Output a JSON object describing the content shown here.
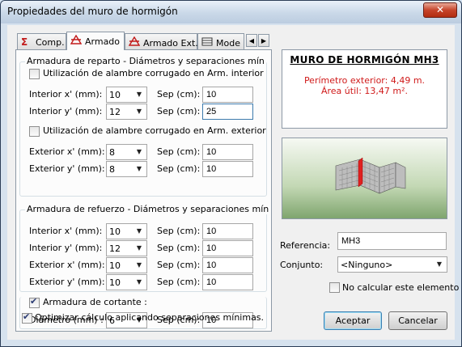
{
  "window": {
    "title": "Propiedades del muro de hormigón",
    "close_label": "✕"
  },
  "tabs": [
    {
      "label": "Comp.",
      "icon": "sigma-icon"
    },
    {
      "label": "Armado",
      "icon": "rebar-icon"
    },
    {
      "label": "Armado Ext.",
      "icon": "rebar-icon"
    },
    {
      "label": "Mode",
      "icon": "model-icon"
    }
  ],
  "tab_scroll": {
    "left": "◀",
    "right": "▶"
  },
  "reparto": {
    "title": "Armadura de reparto - Diámetros y separaciones mín",
    "interior_check": "Utilización de alambre corrugado en Arm. interior",
    "exterior_check": "Utilización de alambre corrugado en Arm. exterior",
    "rows": [
      {
        "label": "Interior x' (mm):",
        "diam": "10",
        "sep_label": "Sep (cm):",
        "sep": "10"
      },
      {
        "label": "Interior y' (mm):",
        "diam": "12",
        "sep_label": "Sep (cm):",
        "sep": "25"
      },
      {
        "label": "Exterior x'  (mm):",
        "diam": "8",
        "sep_label": "Sep (cm):",
        "sep": "10"
      },
      {
        "label": "Exterior y'  (mm):",
        "diam": "8",
        "sep_label": "Sep (cm):",
        "sep": "10"
      }
    ]
  },
  "refuerzo": {
    "title": "Armadura de refuerzo - Diámetros y separaciones mín",
    "rows": [
      {
        "label": "Interior x'  (mm):",
        "diam": "10",
        "sep_label": "Sep (cm):",
        "sep": "10"
      },
      {
        "label": "Interior y'  (mm):",
        "diam": "12",
        "sep_label": "Sep (cm):",
        "sep": "10"
      },
      {
        "label": "Exterior x'  (mm):",
        "diam": "10",
        "sep_label": "Sep (cm):",
        "sep": "10"
      },
      {
        "label": "Exterior y'  (mm):",
        "diam": "10",
        "sep_label": "Sep (cm):",
        "sep": "10"
      }
    ]
  },
  "cortante": {
    "check_label": "Armadura de cortante :",
    "checked": true,
    "diam_label": "Diámetro (mm) :",
    "diam": "6",
    "sep_label": "Sep (cm):",
    "sep": "10"
  },
  "optimize": {
    "label": "Optimizar cálculo aplicando separaciones mínimas.",
    "checked": true
  },
  "preview": {
    "title": "MURO DE HORMIGÓN MH3",
    "perimetro": "Perímetro exterior: 4,49 m.",
    "area": "Área útil: 13,47 m²."
  },
  "referencia": {
    "label": "Referencia:",
    "value": "MH3"
  },
  "conjunto": {
    "label": "Conjunto:",
    "value": "<Ninguno>"
  },
  "no_calcular": {
    "label": "No calcular este elemento",
    "checked": false
  },
  "buttons": {
    "ok": "Aceptar",
    "cancel": "Cancelar"
  },
  "colors": {
    "accent_red": "#d01a1a",
    "titlebar": "#c9d8e8",
    "close": "#c6442a"
  }
}
